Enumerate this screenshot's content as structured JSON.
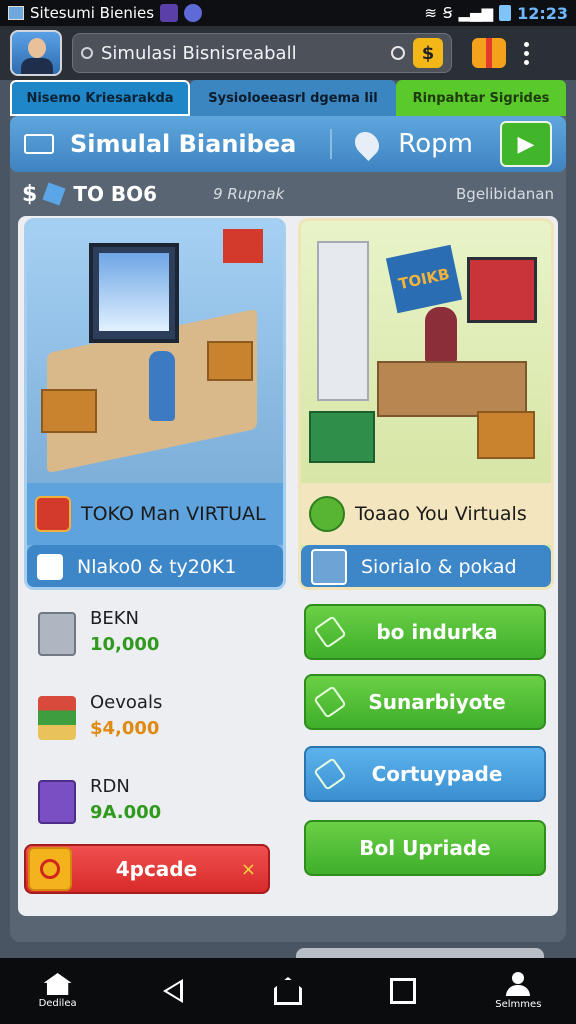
{
  "status_bar": {
    "title": "Sitesumi Bienies",
    "time": "12:23"
  },
  "app_bar": {
    "search_value": "Simulasi Bisnisreaball",
    "coin_symbol": "$"
  },
  "tabs": [
    {
      "label": "Nisemo Kriesarakda",
      "color": "#1f86c7"
    },
    {
      "label": "Sysioloeeasrl dgema lil",
      "color": "#3b86c0"
    },
    {
      "label": "Rinpahtar Sigrides",
      "color": "#59c92b"
    }
  ],
  "header": {
    "title": "Simulal Bianibea",
    "location": "Ropm"
  },
  "stats": {
    "cash_symbol": "$",
    "value_main": "TO BO6",
    "value_secondary": "9",
    "label_secondary": "Rupnak",
    "label_right": "Bgelibidanan"
  },
  "cards": [
    {
      "name": "TOKO Man VIRTUAL",
      "action": "Nlako0 & ty20K1"
    },
    {
      "name": "Toaao You Virtuals",
      "sign": "TOIKB",
      "action": "Siorialo & pokad"
    }
  ],
  "resources": [
    {
      "name": "BEKN",
      "value": "10,000",
      "value_color": "#2f9a1e"
    },
    {
      "name": "Oevoals",
      "value": "$4,000",
      "value_color": "#e08a12"
    },
    {
      "name": "RDN",
      "value": "9A.000",
      "value_color": "#2f9a1e"
    }
  ],
  "actions": [
    {
      "label": "bo indurka",
      "style": "green"
    },
    {
      "label": "Sunarbiyote",
      "style": "green"
    },
    {
      "label": "Cortuypade",
      "style": "blue"
    },
    {
      "label": "Bol Upriade",
      "style": "green"
    }
  ],
  "upgrade_button": {
    "label": "4pcade",
    "close": "×"
  },
  "nav": {
    "home_label": "Dedilea",
    "profile_label": "Selmmes"
  }
}
